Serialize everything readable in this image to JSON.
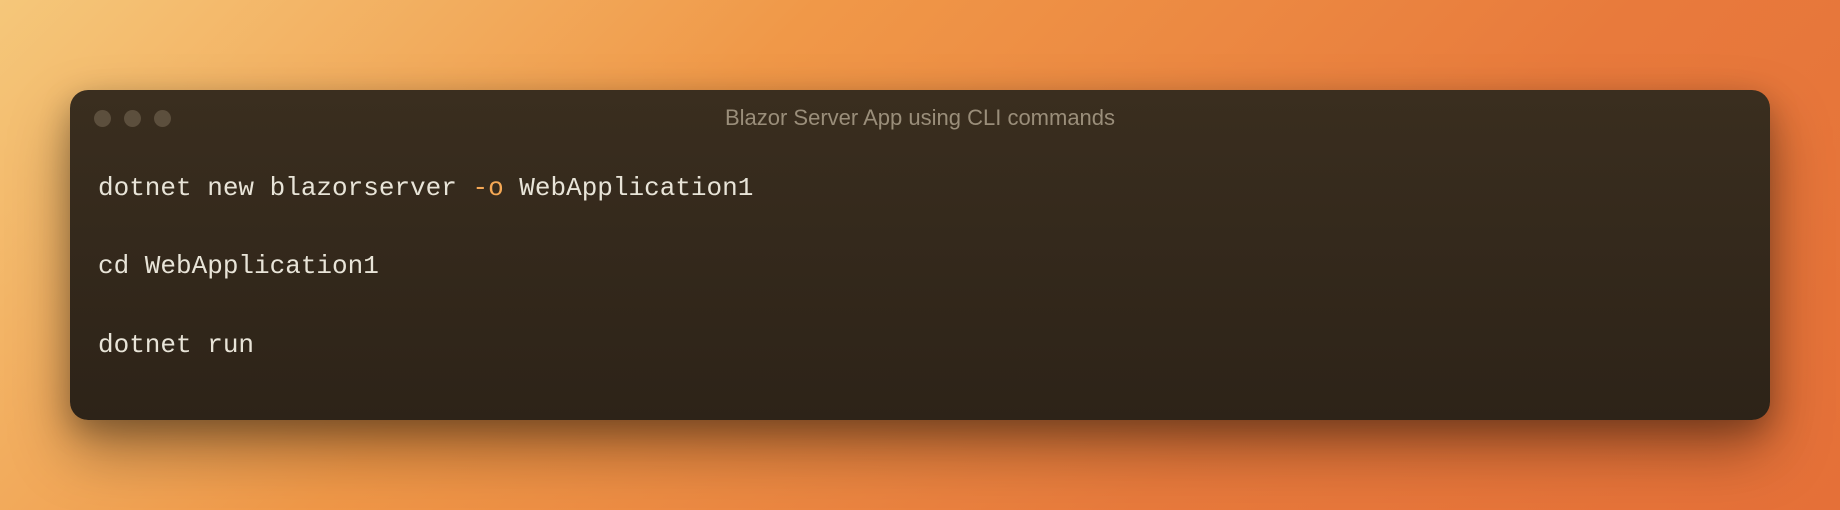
{
  "window": {
    "title": "Blazor Server App using CLI commands"
  },
  "code": {
    "line1_part1": "dotnet new blazorserver ",
    "line1_flag": "-o",
    "line1_part2": " WebApplication1",
    "line2": "cd WebApplication1",
    "line3": "dotnet run"
  },
  "colors": {
    "background_gradient_start": "#f5c77a",
    "background_gradient_end": "#e57038",
    "terminal_bg": "#3a2e1f",
    "text_primary": "#e8e4d8",
    "flag_color": "#f5a855"
  }
}
